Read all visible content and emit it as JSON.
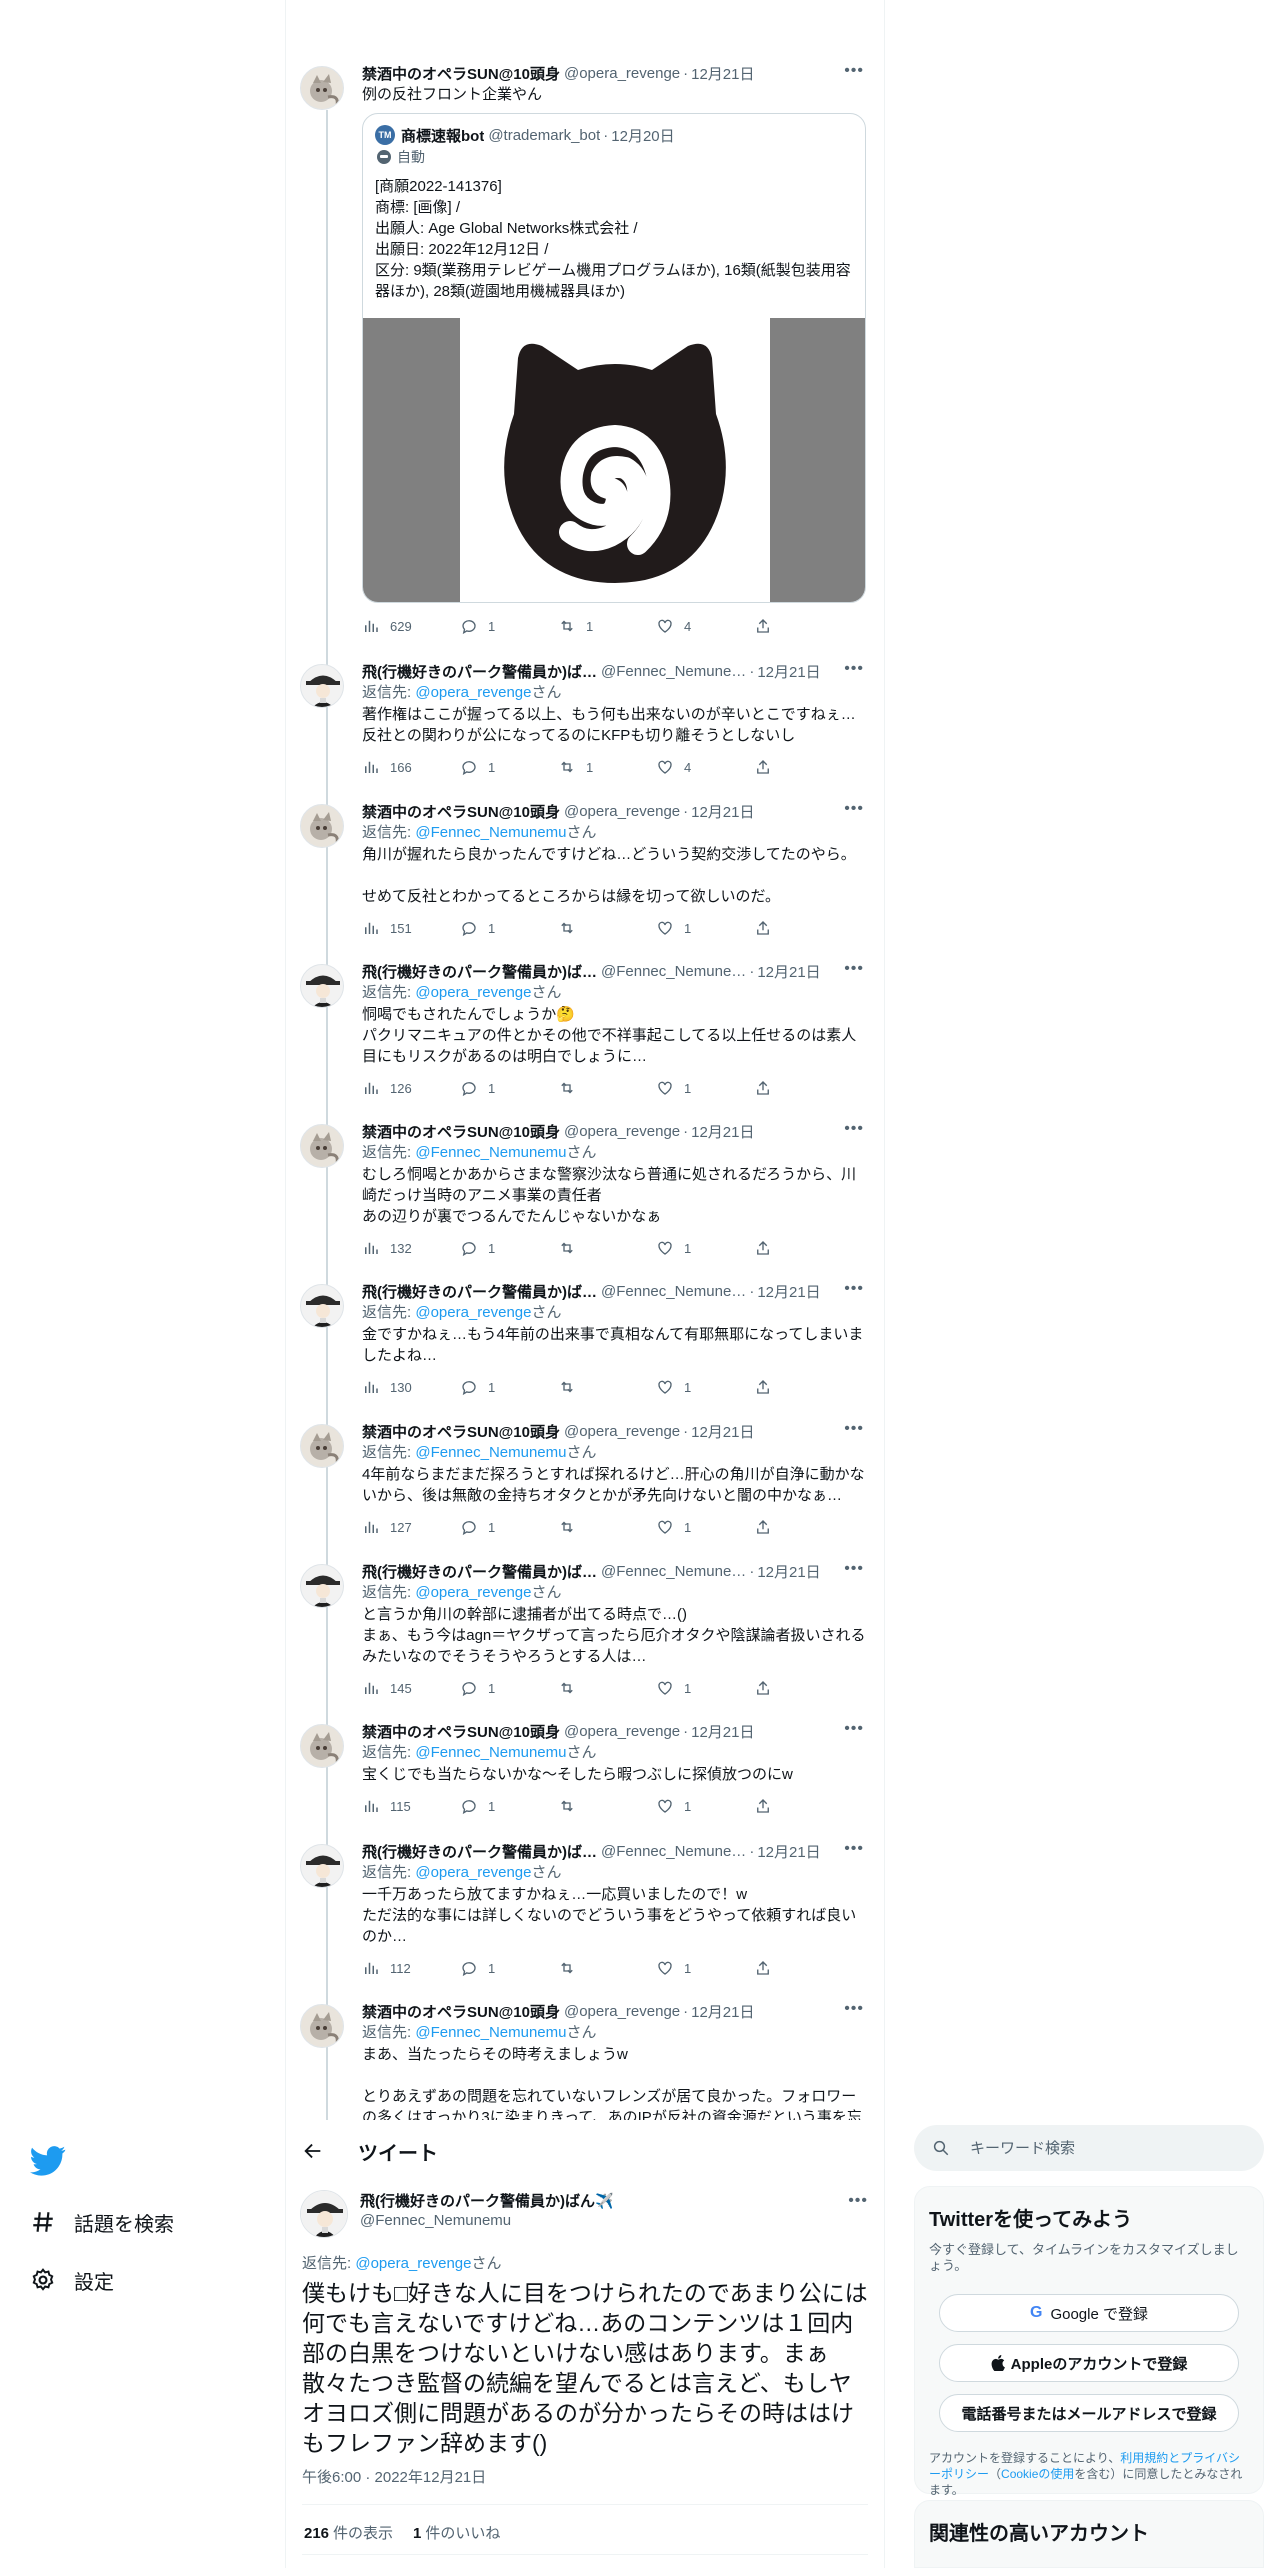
{
  "timeline": {
    "tweets": [
      {
        "name": "禁酒中のオペラSUN@10頭身",
        "handle": "@opera_revenge",
        "date": "12月21日",
        "reply_prefix": "",
        "reply_to": "",
        "reply_suffix": "",
        "text": "例の反社フロント企業やん",
        "stats": {
          "views": "629",
          "replies": "1",
          "retweets": "1",
          "likes": "4"
        },
        "quote": {
          "name": "商標速報bot",
          "handle": "@trademark_bot",
          "date": "12月20日",
          "auto_label": "自動",
          "avatar_text": "TM",
          "text": "[商願2022-141376]\n商標: [画像] /\n出願人: Age Global Networks株式会社 /\n出願日: 2022年12月12日 /\n区分: 9類(業務用テレビゲーム機用プログラムほか), 16類(紙製包装用容器ほか), 28類(遊園地用機械器具ほか)"
        }
      },
      {
        "name": "飛(行機好きのパーク警備員か)ば…",
        "handle": "@Fennec_Nemune…",
        "date": "12月21日",
        "reply_prefix": "返信先: ",
        "reply_to": "@opera_revenge",
        "reply_suffix": "さん",
        "text": "著作権はここが握ってる以上、もう何も出来ないのが辛いとこですねぇ…\n反社との関わりが公になってるのにKFPも切り離そうとしないし",
        "stats": {
          "views": "166",
          "replies": "1",
          "retweets": "1",
          "likes": "4"
        }
      },
      {
        "name": "禁酒中のオペラSUN@10頭身",
        "handle": "@opera_revenge",
        "date": "12月21日",
        "reply_prefix": "返信先: ",
        "reply_to": "@Fennec_Nemunemu",
        "reply_suffix": "さん",
        "text": "角川が握れたら良かったんですけどね…どういう契約交渉してたのやら。\n\nせめて反社とわかってるところからは縁を切って欲しいのだ。",
        "stats": {
          "views": "151",
          "replies": "1",
          "retweets": "",
          "likes": "1"
        }
      },
      {
        "name": "飛(行機好きのパーク警備員か)ば…",
        "handle": "@Fennec_Nemune…",
        "date": "12月21日",
        "reply_prefix": "返信先: ",
        "reply_to": "@opera_revenge",
        "reply_suffix": "さん",
        "text": "恫喝でもされたんでしょうか🤔\nパクリマニキュアの件とかその他で不祥事起こしてる以上任せるのは素人目にもリスクがあるのは明白でしょうに…",
        "stats": {
          "views": "126",
          "replies": "1",
          "retweets": "",
          "likes": "1"
        }
      },
      {
        "name": "禁酒中のオペラSUN@10頭身",
        "handle": "@opera_revenge",
        "date": "12月21日",
        "reply_prefix": "返信先: ",
        "reply_to": "@Fennec_Nemunemu",
        "reply_suffix": "さん",
        "text": "むしろ恫喝とかあからさまな警察沙汰なら普通に処されるだろうから、川崎だっけ当時のアニメ事業の責任者\nあの辺りが裏でつるんでたんじゃないかなぁ",
        "stats": {
          "views": "132",
          "replies": "1",
          "retweets": "",
          "likes": "1"
        }
      },
      {
        "name": "飛(行機好きのパーク警備員か)ば…",
        "handle": "@Fennec_Nemune…",
        "date": "12月21日",
        "reply_prefix": "返信先: ",
        "reply_to": "@opera_revenge",
        "reply_suffix": "さん",
        "text": "金ですかねぇ…もう4年前の出来事で真相なんて有耶無耶になってしまいましたよね…",
        "stats": {
          "views": "130",
          "replies": "1",
          "retweets": "",
          "likes": "1"
        }
      },
      {
        "name": "禁酒中のオペラSUN@10頭身",
        "handle": "@opera_revenge",
        "date": "12月21日",
        "reply_prefix": "返信先: ",
        "reply_to": "@Fennec_Nemunemu",
        "reply_suffix": "さん",
        "text": "4年前ならまだまだ探ろうとすれば探れるけど…肝心の角川が自浄に動かないから、後は無敵の金持ちオタクとかが矛先向けないと闇の中かなぁ…",
        "stats": {
          "views": "127",
          "replies": "1",
          "retweets": "",
          "likes": "1"
        }
      },
      {
        "name": "飛(行機好きのパーク警備員か)ば…",
        "handle": "@Fennec_Nemune…",
        "date": "12月21日",
        "reply_prefix": "返信先: ",
        "reply_to": "@opera_revenge",
        "reply_suffix": "さん",
        "text": "と言うか角川の幹部に逮捕者が出てる時点で…()\nまぁ、もう今はagn＝ヤクザって言ったら厄介オタクや陰謀論者扱いされるみたいなのでそうそうやろうとする人は…",
        "stats": {
          "views": "145",
          "replies": "1",
          "retweets": "",
          "likes": "1"
        }
      },
      {
        "name": "禁酒中のオペラSUN@10頭身",
        "handle": "@opera_revenge",
        "date": "12月21日",
        "reply_prefix": "返信先: ",
        "reply_to": "@Fennec_Nemunemu",
        "reply_suffix": "さん",
        "text": "宝くじでも当たらないかな〜そしたら暇つぶしに探偵放つのにw",
        "stats": {
          "views": "115",
          "replies": "1",
          "retweets": "",
          "likes": "1"
        }
      },
      {
        "name": "飛(行機好きのパーク警備員か)ば…",
        "handle": "@Fennec_Nemune…",
        "date": "12月21日",
        "reply_prefix": "返信先: ",
        "reply_to": "@opera_revenge",
        "reply_suffix": "さん",
        "text": "一千万あったら放てますかねぇ…一応買いましたので！w\nただ法的な事には詳しくないのでどういう事をどうやって依頼すれば良いのか…",
        "stats": {
          "views": "112",
          "replies": "1",
          "retweets": "",
          "likes": "1"
        }
      },
      {
        "name": "禁酒中のオペラSUN@10頭身",
        "handle": "@opera_revenge",
        "date": "12月21日",
        "reply_prefix": "返信先: ",
        "reply_to": "@Fennec_Nemunemu",
        "reply_suffix": "さん",
        "text": "まあ、当たったらその時考えましょうw\n\nとりあえずあの問題を忘れていないフレンズが居て良かった。フォロワーの多くはすっかり3に染まりきって、あのIPが反社の資金源だという事を忘れて褒会してるので…",
        "stats": {
          "views": "",
          "replies": "",
          "retweets": "",
          "likes": ""
        }
      }
    ]
  },
  "nav": {
    "logo": "twitter-bird",
    "explore": "話題を検索",
    "settings": "設定"
  },
  "main_tweet": {
    "header_title": "ツイート",
    "name": "飛(行機好きのパーク警備員か)ばん✈️",
    "handle": "@Fennec_Nemunemu",
    "reply_prefix": "返信先: ",
    "reply_to": "@opera_revenge",
    "reply_suffix": "さん",
    "text": "僕もけも□好きな人に目をつけられたのであまり公には何でも言えないですけどね…あのコンテンツは１回内部の白黒をつけないといけない感はあります。まぁ散々たつき監督の続編を望んでるとは言えど、もしヤオヨロズ側に問題があるのが分かったらその時ははけもフレファン辞めます()",
    "time": "午後6:00 · 2022年12月21日",
    "views_count": "216",
    "views_label": "件の表示",
    "likes_count": "1",
    "likes_label": "件のいいね"
  },
  "right": {
    "search_placeholder": "キーワード検索",
    "signup": {
      "title": "Twitterを使ってみよう",
      "subtitle": "今すぐ登録して、タイムラインをカスタマイズしましょう。",
      "google_g": "G",
      "google": "Google で登録",
      "apple": "Appleのアカウントで登録",
      "phone": "電話番号またはメールアドレスで登録",
      "legal_1": "アカウントを登録することにより、",
      "legal_terms": "利用規約とプライバシーポリシー",
      "legal_2": "（",
      "legal_cookie": "Cookieの使用",
      "legal_3": "を含む）に同意したとみなされます。"
    },
    "related_title": "関連性の高いアカウント"
  },
  "colors": {
    "accent": "#1d9bf0",
    "muted": "#536471",
    "text": "#0f1419",
    "border": "#cfd9de"
  }
}
